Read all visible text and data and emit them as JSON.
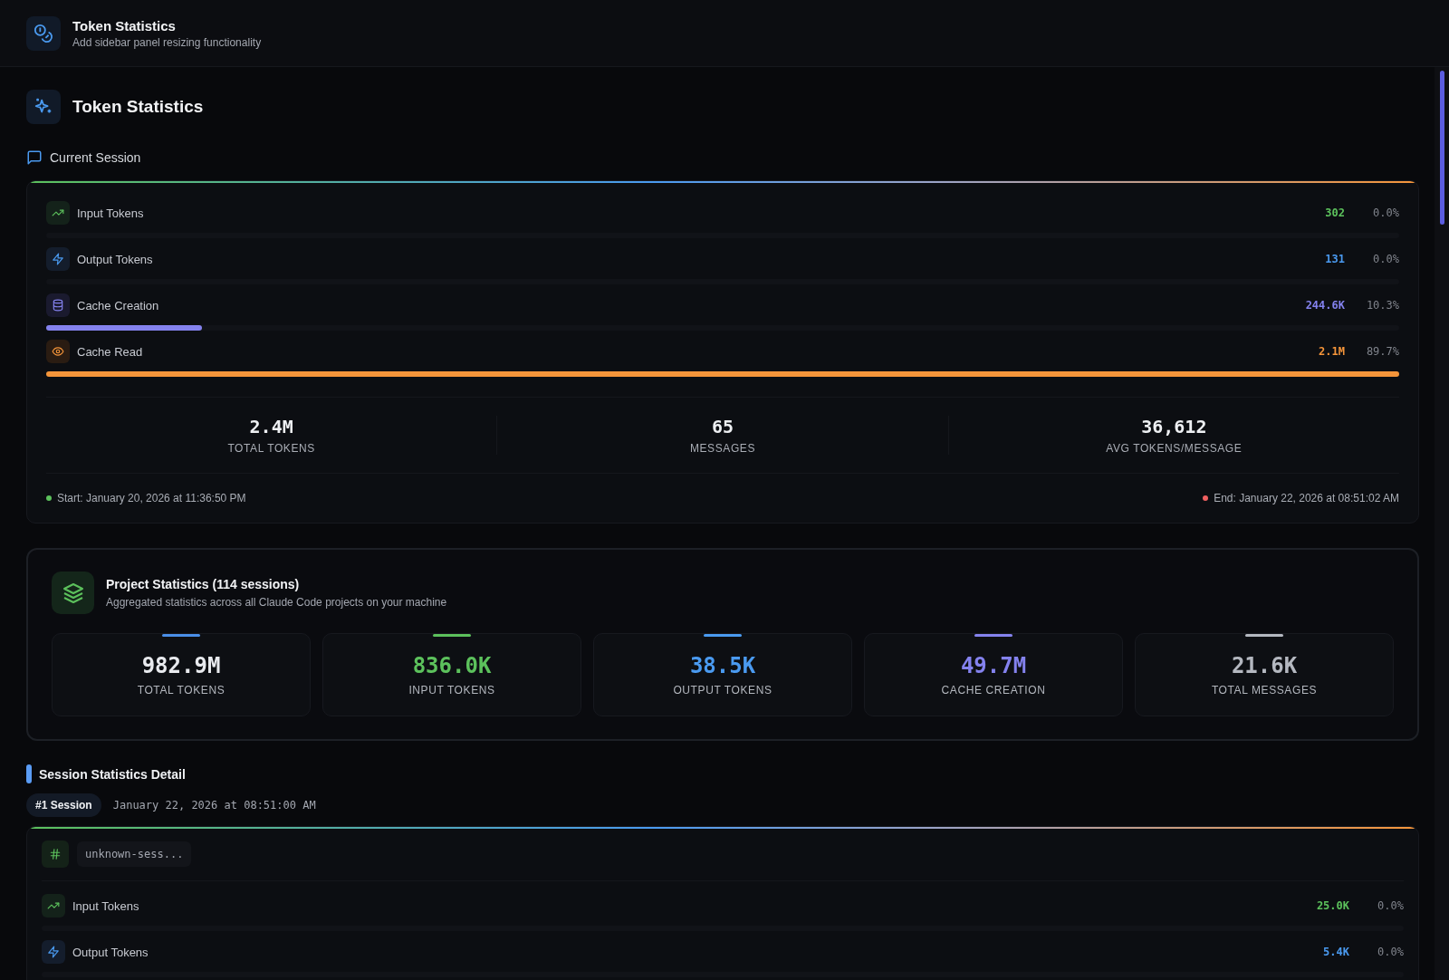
{
  "header": {
    "title": "Token Statistics",
    "subtitle": "Add sidebar panel resizing functionality"
  },
  "page_title": "Token Statistics",
  "current_session": {
    "heading": "Current Session",
    "rows": [
      {
        "kind": "input",
        "label": "Input Tokens",
        "value": "302",
        "percent": "0.0%"
      },
      {
        "kind": "output",
        "label": "Output Tokens",
        "value": "131",
        "percent": "0.0%"
      },
      {
        "kind": "cache_creation",
        "label": "Cache Creation",
        "value": "244.6K",
        "percent": "10.3%",
        "level": 0.115
      },
      {
        "kind": "cache_read",
        "label": "Cache Read",
        "value": "2.1M",
        "percent": "89.7%",
        "level": 1
      }
    ],
    "summary": [
      {
        "value": "2.4M",
        "label": "TOTAL TOKENS"
      },
      {
        "value": "65",
        "label": "MESSAGES"
      },
      {
        "value": "36,612",
        "label": "AVG TOKENS/MESSAGE"
      }
    ],
    "start": "Start: January 20, 2026 at 11:36:50 PM",
    "end": "End: January 22, 2026 at 08:51:02 AM"
  },
  "project": {
    "title": "Project Statistics (114 sessions)",
    "subtitle": "Aggregated statistics across all Claude Code projects on your machine",
    "stats": [
      {
        "kind": "total",
        "value": "982.9M",
        "label": "TOTAL TOKENS",
        "color": "#4a8fe8"
      },
      {
        "kind": "metric",
        "value": "836.0K",
        "label": "INPUT TOKENS",
        "color": "#5cc15c"
      },
      {
        "kind": "metric",
        "value": "38.5K",
        "label": "OUTPUT TOKENS",
        "color": "#4a9af0"
      },
      {
        "kind": "metric",
        "value": "49.7M",
        "label": "CACHE CREATION",
        "color": "#8482ee"
      },
      {
        "kind": "metric",
        "value": "21.6K",
        "label": "TOTAL MESSAGES",
        "color": "#b4b8c0"
      }
    ]
  },
  "session_detail": {
    "heading": "Session Statistics Detail",
    "sessions": [
      {
        "badge": "#1 Session",
        "date": "January 22, 2026 at 08:51:00 AM",
        "id": "unknown-sess...",
        "rows": [
          {
            "kind": "input",
            "label": "Input Tokens",
            "value": "25.0K",
            "percent": "0.0%"
          },
          {
            "kind": "output",
            "label": "Output Tokens",
            "value": "5.4K",
            "percent": "0.0%"
          }
        ]
      }
    ]
  }
}
